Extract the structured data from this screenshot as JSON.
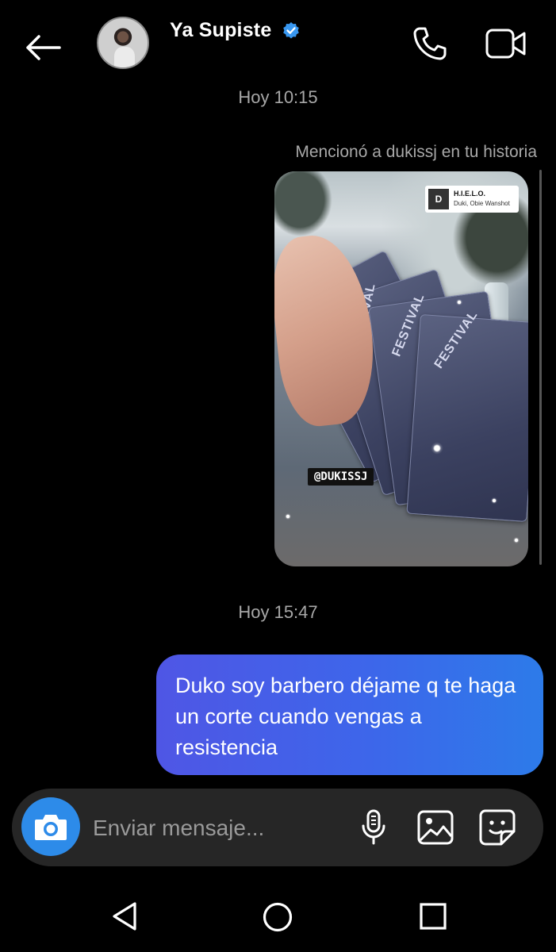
{
  "header": {
    "contact_name": "Ya Supiste",
    "back_icon": "arrow-left-icon",
    "verified_icon": "verified-badge-icon",
    "call_icon": "phone-icon",
    "video_icon": "video-camera-icon",
    "accent_color": "#3897f0"
  },
  "thread": {
    "timestamp_1": "Hoy 10:15",
    "story_mention_text": "Mencionó a dukissj en tu historia",
    "story": {
      "song_title": "H.I.E.L.O.",
      "song_artists": "Duki, Obie Wanshot",
      "song_art_text": "D",
      "mention_tag": "@DUKISSJ",
      "ticket_word": "FESTIVAL"
    },
    "timestamp_2": "Hoy 15:47",
    "sent_message": "Duko soy barbero déjame q te haga un corte cuando vengas a resistencia",
    "bubble_gradient": [
      "#4f56e5",
      "#2d7be9"
    ]
  },
  "composer": {
    "placeholder": "Enviar mensaje...",
    "camera_icon": "camera-icon",
    "mic_icon": "microphone-icon",
    "gallery_icon": "image-icon",
    "sticker_icon": "sticker-icon",
    "camera_color": "#2d8be9"
  },
  "navbar": {
    "back_icon": "triangle-back-icon",
    "home_icon": "circle-home-icon",
    "recents_icon": "square-recents-icon"
  }
}
